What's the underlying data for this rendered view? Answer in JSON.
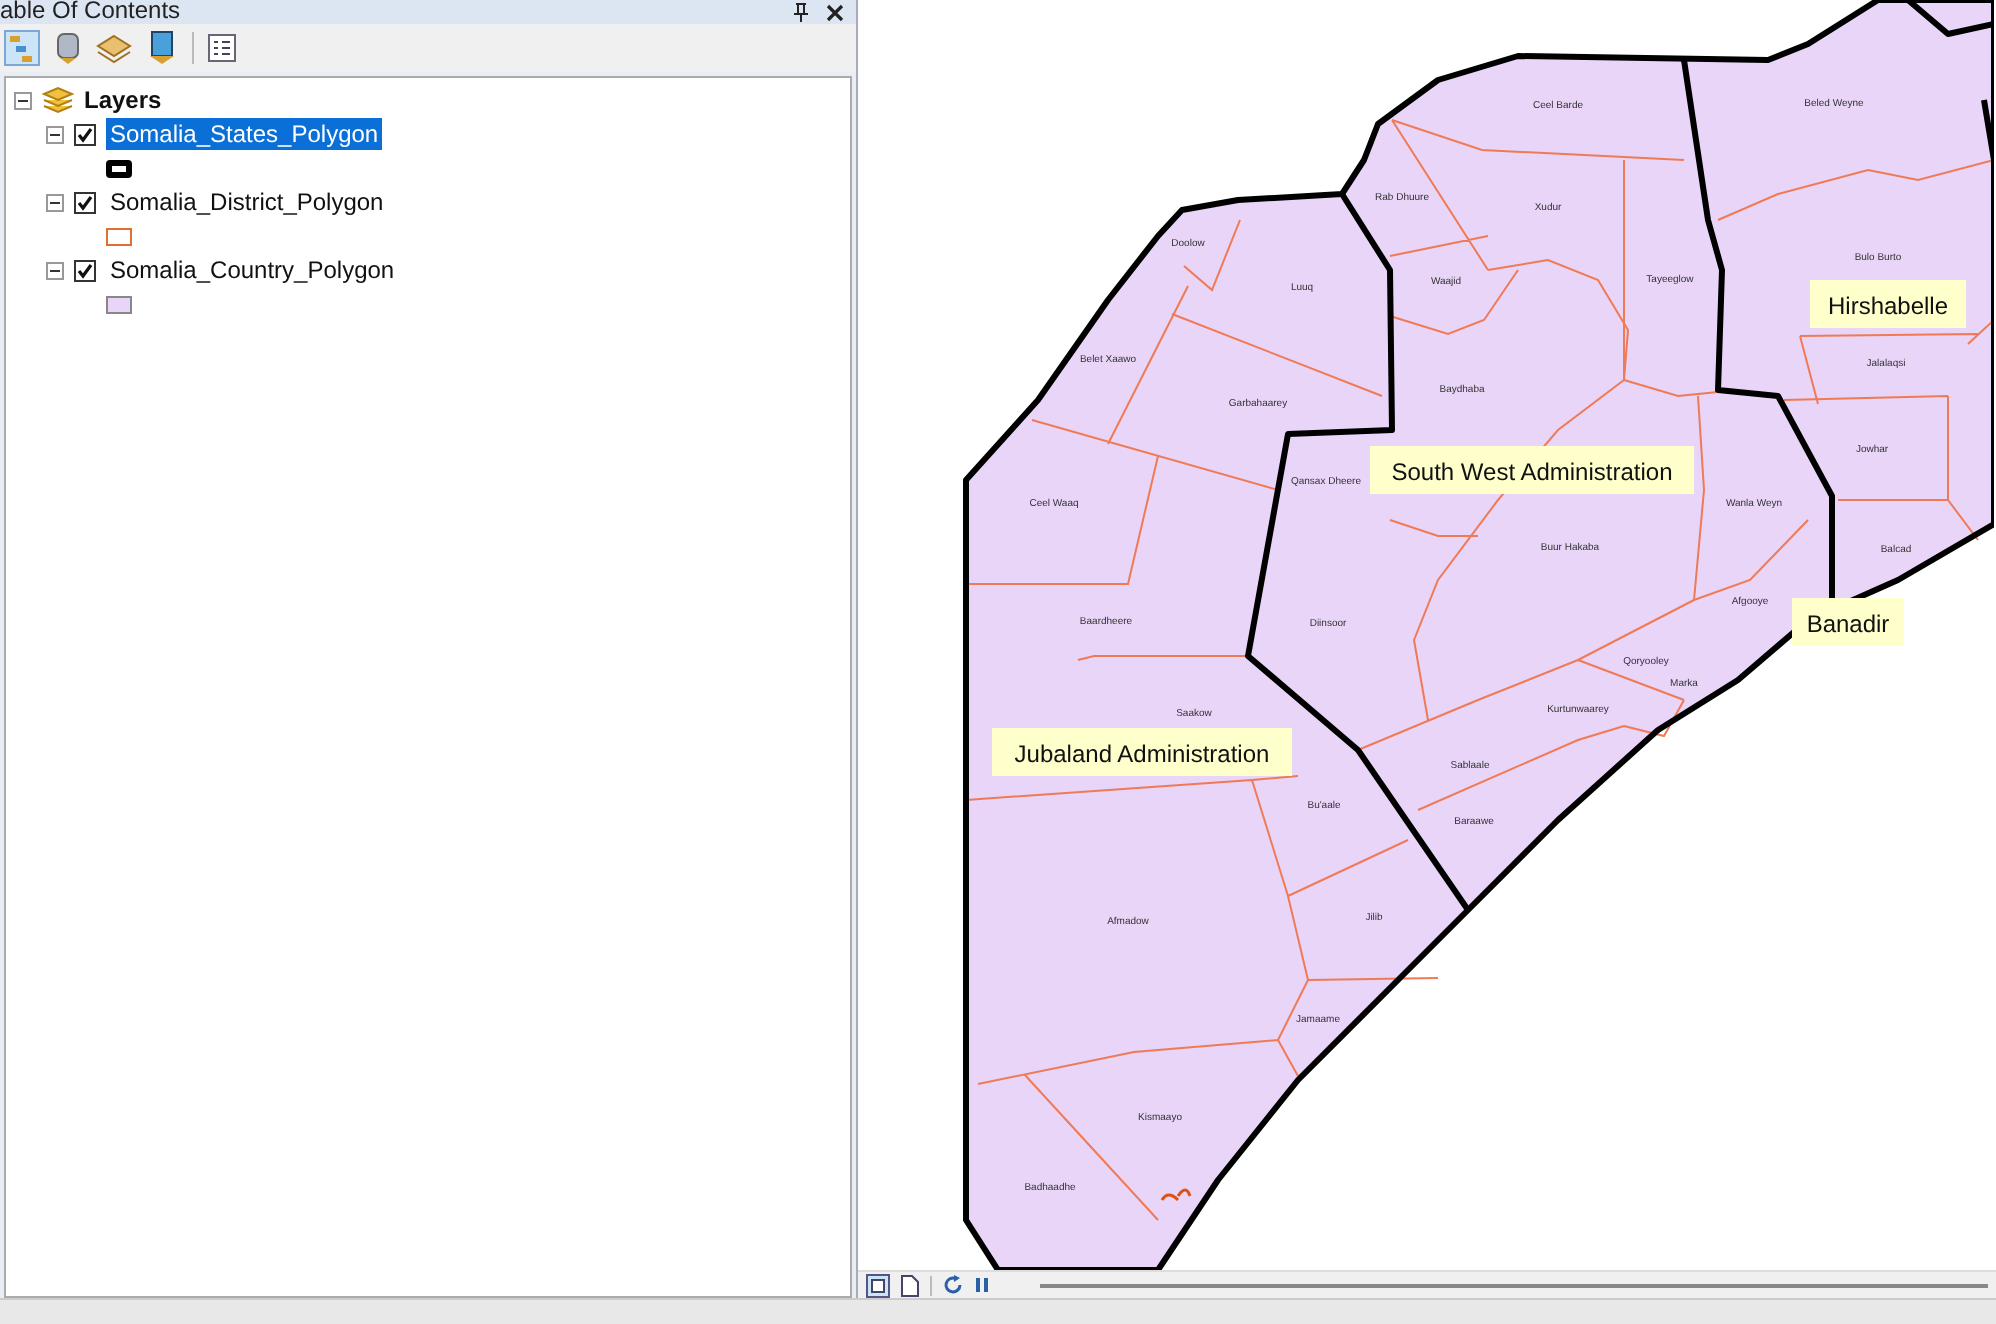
{
  "toc": {
    "title": "able Of Contents"
  },
  "layers": {
    "root": {
      "label": "Layers",
      "expanded": true
    },
    "items": [
      {
        "name": "Somalia_States_Polygon",
        "checked": true,
        "selected": true,
        "expanded": true,
        "kind": "thick-outline"
      },
      {
        "name": "Somalia_District_Polygon",
        "checked": true,
        "selected": false,
        "expanded": true,
        "kind": "thin-outline"
      },
      {
        "name": "Somalia_Country_Polygon",
        "checked": true,
        "selected": false,
        "expanded": true,
        "kind": "fill"
      }
    ]
  },
  "map": {
    "state_labels": [
      "South West Administration",
      "Hirshabelle",
      "Banadir",
      "Jubaland Administration"
    ],
    "district_labels": [
      "Ceel Barde",
      "Beled Weyne",
      "Rab Dhuure",
      "Xudur",
      "Doolow",
      "Luuq",
      "Waajid",
      "Tayeeglow",
      "Bulo Burto",
      "Belet Xaawo",
      "Baydhaba",
      "Jalalaqsi",
      "Garbahaarey",
      "Qansax Dheere",
      "Ceel Waaq",
      "Wanla Weyn",
      "Jowhar",
      "Buur Hakaba",
      "Afgooye",
      "Balcad",
      "Baardheere",
      "Diinsoor",
      "Qoryooley",
      "Kurtunwaarey",
      "Marka",
      "Saakow",
      "Sablaale",
      "Bu'aale",
      "Baraawe",
      "Afmadow",
      "Jilib",
      "Jamaame",
      "Kismaayo",
      "Badhaadhe"
    ]
  }
}
